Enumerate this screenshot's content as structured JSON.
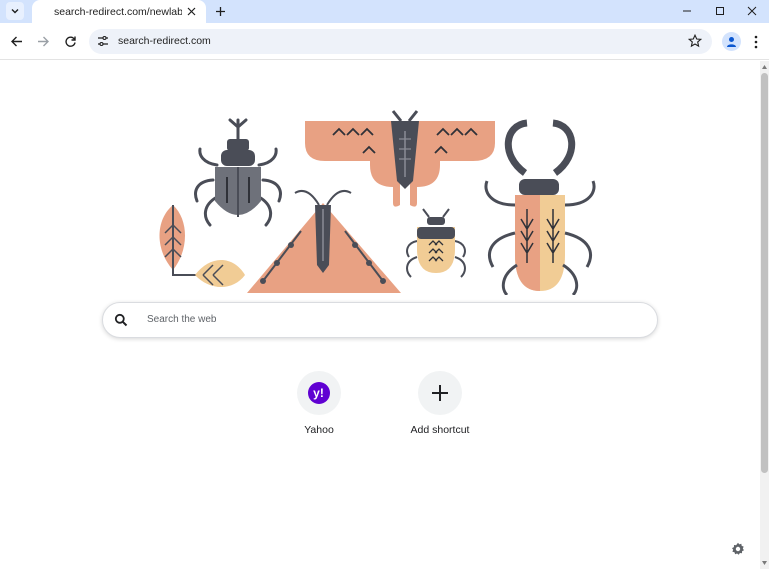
{
  "browser": {
    "tab_title": "search-redirect.com/newlab?ke",
    "url": "search-redirect.com"
  },
  "colors": {
    "tabstrip_bg": "#d3e3fd",
    "omnibox_bg": "#eef2f9",
    "doodle_peach": "#e8a183",
    "doodle_yellow": "#f1cc95",
    "doodle_slate": "#4a4d57"
  },
  "search": {
    "placeholder": "Search the web"
  },
  "shortcuts": [
    {
      "label": "Yahoo",
      "icon": "yahoo-icon"
    },
    {
      "label": "Add shortcut",
      "icon": "plus-icon"
    }
  ],
  "icons": {
    "customize": "gear-icon"
  }
}
